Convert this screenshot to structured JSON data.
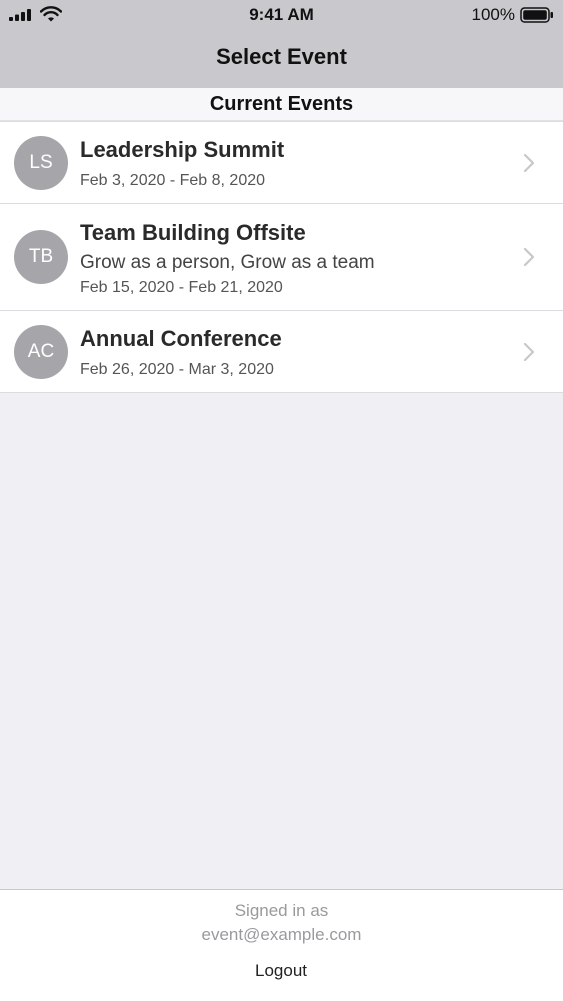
{
  "status_bar": {
    "time": "9:41 AM",
    "battery_percent": "100%",
    "icons": [
      "signal-icon",
      "wifi-icon",
      "battery-icon"
    ]
  },
  "nav": {
    "title": "Select Event"
  },
  "section": {
    "title": "Current Events"
  },
  "events": [
    {
      "initials": "LS",
      "title": "Leadership Summit",
      "dates": "Feb 3, 2020 - Feb 8, 2020"
    },
    {
      "initials": "TB",
      "title": "Team Building Offsite",
      "subtitle": "Grow as a person, Grow as a team",
      "dates": "Feb 15, 2020 - Feb 21, 2020"
    },
    {
      "initials": "AC",
      "title": "Annual Conference",
      "dates": "Feb 26, 2020 - Mar 3, 2020"
    }
  ],
  "footer": {
    "signed_in_label": "Signed in as",
    "email": "event@example.com",
    "logout_label": "Logout"
  },
  "colors": {
    "bar_background": "#c9c8cc",
    "page_background": "#efeff4",
    "avatar_background": "#a6a6aa",
    "chevron": "#c7c7cc",
    "muted_text": "#9a9a9e"
  }
}
